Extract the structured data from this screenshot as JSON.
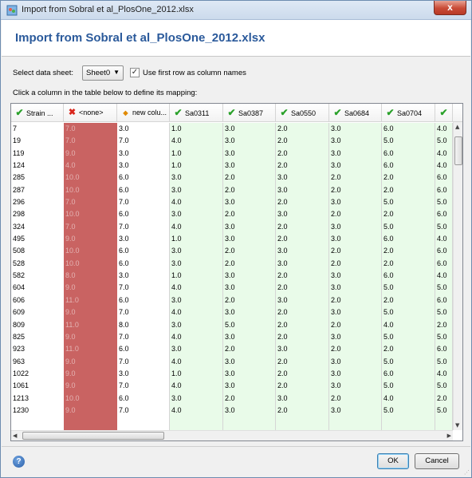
{
  "window": {
    "title": "Import from Sobral et al_PlosOne_2012.xlsx",
    "close_glyph": "x"
  },
  "header": {
    "title": "Import from Sobral et al_PlosOne_2012.xlsx"
  },
  "controls": {
    "sheet_label": "Select data sheet:",
    "sheet_value": "Sheet0",
    "first_row_checked": true,
    "first_row_label": "Use first row as column names"
  },
  "hint": "Click a column in the table below to define its mapping:",
  "colors": {
    "mapped_column": "#e9fbe9",
    "unmapped_column": "#c96362",
    "accent_title": "#2b5a9b",
    "check_icon": "#2aa12a",
    "x_icon": "#d9261c"
  },
  "table": {
    "columns": [
      {
        "icon": "check-icon",
        "label": "Strain ...",
        "kind": "key"
      },
      {
        "icon": "x-icon",
        "label": "<none>",
        "kind": "none"
      },
      {
        "icon": "new-icon",
        "label": "new colu...",
        "kind": "newcol"
      },
      {
        "icon": "check-icon",
        "label": "Sa0311",
        "kind": "mapped"
      },
      {
        "icon": "check-icon",
        "label": "Sa0387",
        "kind": "mapped"
      },
      {
        "icon": "check-icon",
        "label": "Sa0550",
        "kind": "mapped"
      },
      {
        "icon": "check-icon",
        "label": "Sa0684",
        "kind": "mapped"
      },
      {
        "icon": "check-icon",
        "label": "Sa0704",
        "kind": "mapped"
      },
      {
        "icon": "check-icon",
        "label": "",
        "kind": "mapped"
      }
    ],
    "rows": [
      [
        "7",
        "7.0",
        "3.0",
        "1.0",
        "3.0",
        "2.0",
        "3.0",
        "6.0",
        "4.0"
      ],
      [
        "19",
        "7.0",
        "7.0",
        "4.0",
        "3.0",
        "2.0",
        "3.0",
        "5.0",
        "5.0"
      ],
      [
        "119",
        "9.0",
        "3.0",
        "1.0",
        "3.0",
        "2.0",
        "3.0",
        "6.0",
        "4.0"
      ],
      [
        "124",
        "4.0",
        "3.0",
        "1.0",
        "3.0",
        "2.0",
        "3.0",
        "6.0",
        "4.0"
      ],
      [
        "285",
        "10.0",
        "6.0",
        "3.0",
        "2.0",
        "3.0",
        "2.0",
        "2.0",
        "6.0"
      ],
      [
        "287",
        "10.0",
        "6.0",
        "3.0",
        "2.0",
        "3.0",
        "2.0",
        "2.0",
        "6.0"
      ],
      [
        "296",
        "7.0",
        "7.0",
        "4.0",
        "3.0",
        "2.0",
        "3.0",
        "5.0",
        "5.0"
      ],
      [
        "298",
        "10.0",
        "6.0",
        "3.0",
        "2.0",
        "3.0",
        "2.0",
        "2.0",
        "6.0"
      ],
      [
        "324",
        "7.0",
        "7.0",
        "4.0",
        "3.0",
        "2.0",
        "3.0",
        "5.0",
        "5.0"
      ],
      [
        "495",
        "9.0",
        "3.0",
        "1.0",
        "3.0",
        "2.0",
        "3.0",
        "6.0",
        "4.0"
      ],
      [
        "508",
        "10.0",
        "6.0",
        "3.0",
        "2.0",
        "3.0",
        "2.0",
        "2.0",
        "6.0"
      ],
      [
        "528",
        "10.0",
        "6.0",
        "3.0",
        "2.0",
        "3.0",
        "2.0",
        "2.0",
        "6.0"
      ],
      [
        "582",
        "8.0",
        "3.0",
        "1.0",
        "3.0",
        "2.0",
        "3.0",
        "6.0",
        "4.0"
      ],
      [
        "604",
        "9.0",
        "7.0",
        "4.0",
        "3.0",
        "2.0",
        "3.0",
        "5.0",
        "5.0"
      ],
      [
        "606",
        "11.0",
        "6.0",
        "3.0",
        "2.0",
        "3.0",
        "2.0",
        "2.0",
        "6.0"
      ],
      [
        "609",
        "9.0",
        "7.0",
        "4.0",
        "3.0",
        "2.0",
        "3.0",
        "5.0",
        "5.0"
      ],
      [
        "809",
        "11.0",
        "8.0",
        "3.0",
        "5.0",
        "2.0",
        "2.0",
        "4.0",
        "2.0"
      ],
      [
        "825",
        "9.0",
        "7.0",
        "4.0",
        "3.0",
        "2.0",
        "3.0",
        "5.0",
        "5.0"
      ],
      [
        "923",
        "11.0",
        "6.0",
        "3.0",
        "2.0",
        "3.0",
        "2.0",
        "2.0",
        "6.0"
      ],
      [
        "963",
        "9.0",
        "7.0",
        "4.0",
        "3.0",
        "2.0",
        "3.0",
        "5.0",
        "5.0"
      ],
      [
        "1022",
        "9.0",
        "3.0",
        "1.0",
        "3.0",
        "2.0",
        "3.0",
        "6.0",
        "4.0"
      ],
      [
        "1061",
        "9.0",
        "7.0",
        "4.0",
        "3.0",
        "2.0",
        "3.0",
        "5.0",
        "5.0"
      ],
      [
        "1213",
        "10.0",
        "6.0",
        "3.0",
        "2.0",
        "3.0",
        "2.0",
        "4.0",
        "2.0"
      ],
      [
        "1230",
        "9.0",
        "7.0",
        "4.0",
        "3.0",
        "2.0",
        "3.0",
        "5.0",
        "5.0"
      ]
    ]
  },
  "footer": {
    "help_glyph": "?",
    "ok_label": "OK",
    "cancel_label": "Cancel"
  }
}
